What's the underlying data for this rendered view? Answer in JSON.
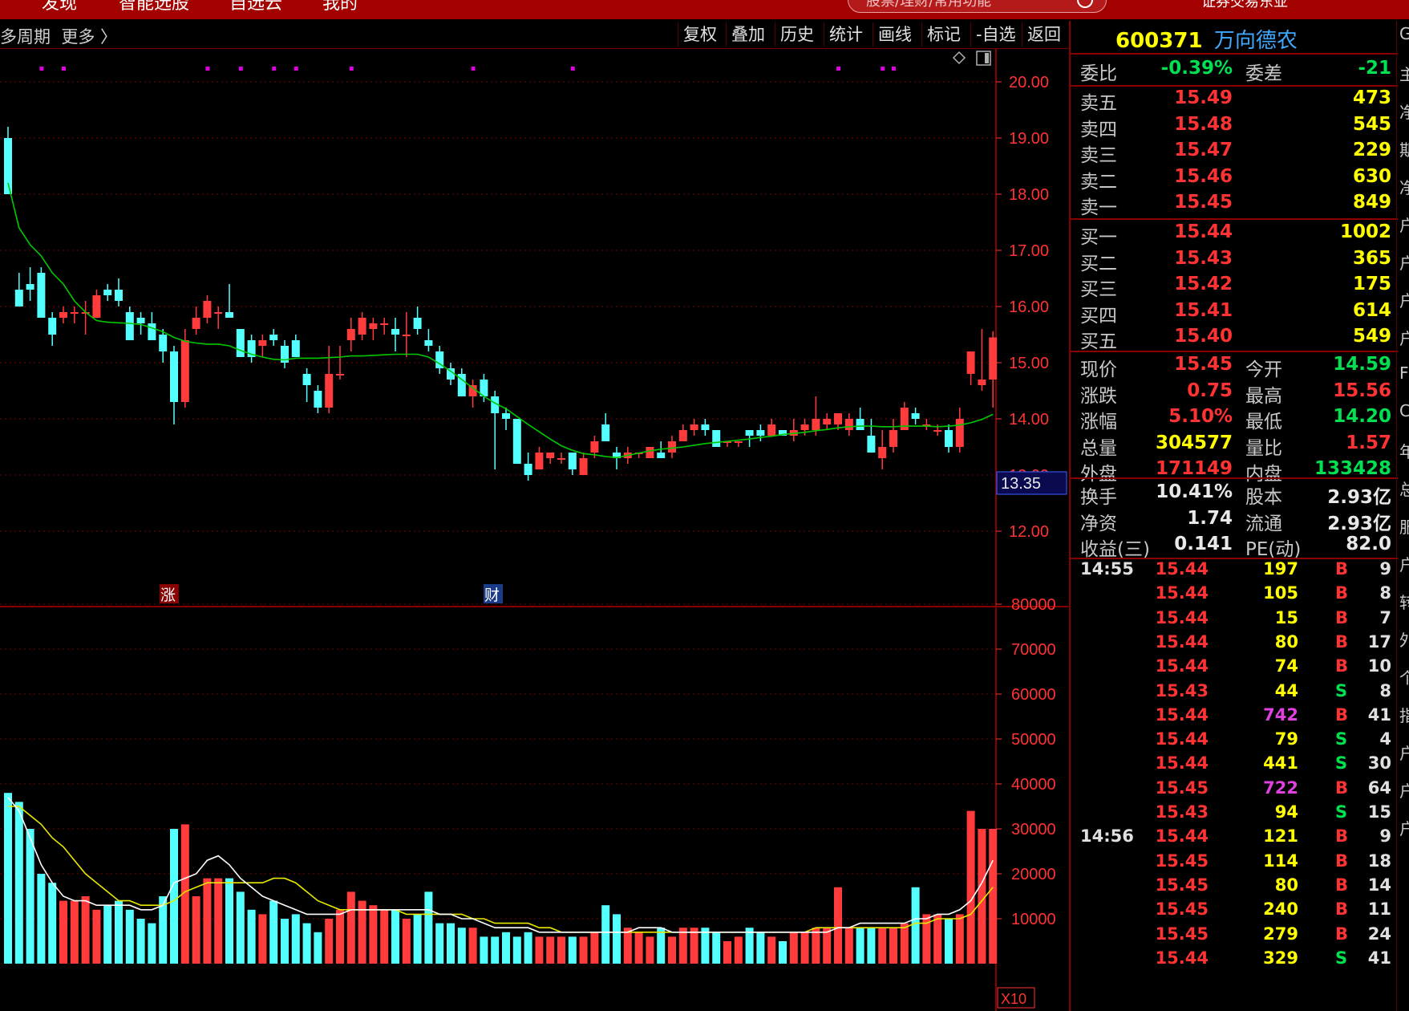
{
  "topnav": {
    "items": [
      "发现",
      "智能选股",
      "自选云",
      "我的"
    ],
    "search_placeholder": "股票/理财/常用功能",
    "right_text": "证券交易东亚"
  },
  "toolbar": {
    "period_label": "多周期",
    "more_label": "更多 〉",
    "buttons": [
      "复权",
      "叠加",
      "历史",
      "统计",
      "画线",
      "标记",
      "-自选",
      "返回"
    ]
  },
  "chart": {
    "price_axis_labels": [
      "20.00",
      "19.00",
      "18.00",
      "17.00",
      "16.00",
      "15.00",
      "14.00",
      "13.00",
      "12.00"
    ],
    "current_price_tag": "13.35",
    "volume_axis_labels": [
      "80000",
      "70000",
      "60000",
      "50000",
      "40000",
      "30000",
      "20000",
      "10000"
    ],
    "volume_unit_label": "X10",
    "event_marker_zhang": "涨",
    "event_marker_cai": "财",
    "colors": {
      "up": "#ff3b3b",
      "down": "#54ffff",
      "ma_green": "#00c800",
      "ma_white": "#ffffff",
      "ma_yellow": "#e8e800",
      "grid": "#7a0000",
      "marker_dot": "#e000e0"
    }
  },
  "chart_data": {
    "type": "candlestick",
    "ylim": [
      12,
      20.5
    ],
    "volume_ylim": [
      0,
      80000
    ],
    "candles": [
      {
        "o": 19.0,
        "h": 19.2,
        "l": 18.0,
        "c": 18.0
      },
      {
        "o": 16.3,
        "h": 16.6,
        "l": 16.0,
        "c": 16.0
      },
      {
        "o": 16.4,
        "h": 16.7,
        "l": 16.1,
        "c": 16.3
      },
      {
        "o": 16.6,
        "h": 16.7,
        "l": 15.8,
        "c": 15.8
      },
      {
        "o": 15.8,
        "h": 15.9,
        "l": 15.3,
        "c": 15.5
      },
      {
        "o": 15.8,
        "h": 16.0,
        "l": 15.7,
        "c": 15.9
      },
      {
        "o": 15.9,
        "h": 16.0,
        "l": 15.7,
        "c": 15.9
      },
      {
        "o": 15.9,
        "h": 16.1,
        "l": 15.5,
        "c": 15.9
      },
      {
        "o": 15.8,
        "h": 16.3,
        "l": 15.8,
        "c": 16.2
      },
      {
        "o": 16.3,
        "h": 16.4,
        "l": 16.1,
        "c": 16.2
      },
      {
        "o": 16.3,
        "h": 16.5,
        "l": 16.0,
        "c": 16.1
      },
      {
        "o": 15.9,
        "h": 16.0,
        "l": 15.4,
        "c": 15.4
      },
      {
        "o": 15.8,
        "h": 15.9,
        "l": 15.5,
        "c": 15.7
      },
      {
        "o": 15.7,
        "h": 15.9,
        "l": 15.4,
        "c": 15.4
      },
      {
        "o": 15.5,
        "h": 15.6,
        "l": 15.0,
        "c": 15.2
      },
      {
        "o": 15.2,
        "h": 15.3,
        "l": 13.9,
        "c": 14.3
      },
      {
        "o": 14.3,
        "h": 15.6,
        "l": 14.2,
        "c": 15.4
      },
      {
        "o": 15.6,
        "h": 16.0,
        "l": 15.5,
        "c": 15.8
      },
      {
        "o": 15.8,
        "h": 16.2,
        "l": 15.7,
        "c": 16.1
      },
      {
        "o": 15.9,
        "h": 16.0,
        "l": 15.6,
        "c": 15.9
      },
      {
        "o": 15.9,
        "h": 16.4,
        "l": 15.8,
        "c": 15.8
      },
      {
        "o": 15.6,
        "h": 15.6,
        "l": 15.1,
        "c": 15.1
      },
      {
        "o": 15.4,
        "h": 15.5,
        "l": 15.0,
        "c": 15.1
      },
      {
        "o": 15.3,
        "h": 15.5,
        "l": 15.1,
        "c": 15.4
      },
      {
        "o": 15.5,
        "h": 15.6,
        "l": 15.3,
        "c": 15.4
      },
      {
        "o": 15.3,
        "h": 15.4,
        "l": 14.9,
        "c": 15.0
      },
      {
        "o": 15.4,
        "h": 15.5,
        "l": 15.1,
        "c": 15.1
      },
      {
        "o": 14.8,
        "h": 14.9,
        "l": 14.3,
        "c": 14.6
      },
      {
        "o": 14.5,
        "h": 14.6,
        "l": 14.1,
        "c": 14.2
      },
      {
        "o": 14.2,
        "h": 15.3,
        "l": 14.1,
        "c": 14.8
      },
      {
        "o": 14.8,
        "h": 15.3,
        "l": 14.7,
        "c": 14.8
      },
      {
        "o": 15.4,
        "h": 15.8,
        "l": 15.2,
        "c": 15.6
      },
      {
        "o": 15.5,
        "h": 15.9,
        "l": 15.4,
        "c": 15.8
      },
      {
        "o": 15.6,
        "h": 15.8,
        "l": 15.4,
        "c": 15.7
      },
      {
        "o": 15.7,
        "h": 15.8,
        "l": 15.5,
        "c": 15.7
      },
      {
        "o": 15.6,
        "h": 15.8,
        "l": 15.2,
        "c": 15.5
      },
      {
        "o": 15.5,
        "h": 15.9,
        "l": 15.1,
        "c": 15.5
      },
      {
        "o": 15.8,
        "h": 16.0,
        "l": 15.5,
        "c": 15.6
      },
      {
        "o": 15.4,
        "h": 15.6,
        "l": 15.2,
        "c": 15.3
      },
      {
        "o": 15.2,
        "h": 15.3,
        "l": 14.8,
        "c": 14.9
      },
      {
        "o": 14.9,
        "h": 15.0,
        "l": 14.6,
        "c": 14.7
      },
      {
        "o": 14.8,
        "h": 14.9,
        "l": 14.4,
        "c": 14.4
      },
      {
        "o": 14.4,
        "h": 14.7,
        "l": 14.2,
        "c": 14.6
      },
      {
        "o": 14.7,
        "h": 14.8,
        "l": 14.3,
        "c": 14.4
      },
      {
        "o": 14.4,
        "h": 14.5,
        "l": 13.1,
        "c": 14.1
      },
      {
        "o": 14.1,
        "h": 14.2,
        "l": 13.8,
        "c": 14.0
      },
      {
        "o": 14.0,
        "h": 14.0,
        "l": 13.2,
        "c": 13.2
      },
      {
        "o": 13.2,
        "h": 13.4,
        "l": 12.9,
        "c": 13.0
      },
      {
        "o": 13.1,
        "h": 13.5,
        "l": 13.1,
        "c": 13.4
      },
      {
        "o": 13.3,
        "h": 13.4,
        "l": 13.2,
        "c": 13.4
      },
      {
        "o": 13.3,
        "h": 13.4,
        "l": 13.2,
        "c": 13.3
      },
      {
        "o": 13.4,
        "h": 13.4,
        "l": 13.0,
        "c": 13.1
      },
      {
        "o": 13.0,
        "h": 13.4,
        "l": 13.0,
        "c": 13.3
      },
      {
        "o": 13.4,
        "h": 13.7,
        "l": 13.3,
        "c": 13.6
      },
      {
        "o": 13.9,
        "h": 14.1,
        "l": 13.6,
        "c": 13.6
      },
      {
        "o": 13.4,
        "h": 13.5,
        "l": 13.1,
        "c": 13.3
      },
      {
        "o": 13.3,
        "h": 13.5,
        "l": 13.2,
        "c": 13.4
      },
      {
        "o": 13.4,
        "h": 13.4,
        "l": 13.3,
        "c": 13.4
      },
      {
        "o": 13.3,
        "h": 13.5,
        "l": 13.3,
        "c": 13.5
      },
      {
        "o": 13.4,
        "h": 13.6,
        "l": 13.3,
        "c": 13.3
      },
      {
        "o": 13.4,
        "h": 13.7,
        "l": 13.3,
        "c": 13.6
      },
      {
        "o": 13.6,
        "h": 13.9,
        "l": 13.6,
        "c": 13.8
      },
      {
        "o": 13.8,
        "h": 14.0,
        "l": 13.7,
        "c": 13.9
      },
      {
        "o": 13.9,
        "h": 14.0,
        "l": 13.7,
        "c": 13.8
      },
      {
        "o": 13.8,
        "h": 13.8,
        "l": 13.5,
        "c": 13.5
      },
      {
        "o": 13.6,
        "h": 13.6,
        "l": 13.5,
        "c": 13.6
      },
      {
        "o": 13.6,
        "h": 13.6,
        "l": 13.5,
        "c": 13.6
      },
      {
        "o": 13.8,
        "h": 13.8,
        "l": 13.5,
        "c": 13.7
      },
      {
        "o": 13.8,
        "h": 13.9,
        "l": 13.6,
        "c": 13.7
      },
      {
        "o": 13.7,
        "h": 14.0,
        "l": 13.7,
        "c": 13.9
      },
      {
        "o": 13.8,
        "h": 13.8,
        "l": 13.7,
        "c": 13.7
      },
      {
        "o": 13.7,
        "h": 14.0,
        "l": 13.6,
        "c": 13.8
      },
      {
        "o": 13.8,
        "h": 14.0,
        "l": 13.7,
        "c": 13.9
      },
      {
        "o": 13.8,
        "h": 14.4,
        "l": 13.7,
        "c": 14.0
      },
      {
        "o": 13.9,
        "h": 14.1,
        "l": 13.8,
        "c": 14.0
      },
      {
        "o": 13.9,
        "h": 14.1,
        "l": 13.8,
        "c": 14.1
      },
      {
        "o": 13.8,
        "h": 14.1,
        "l": 13.7,
        "c": 14.0
      },
      {
        "o": 14.0,
        "h": 14.2,
        "l": 13.8,
        "c": 13.8
      },
      {
        "o": 13.7,
        "h": 14.0,
        "l": 13.4,
        "c": 13.4
      },
      {
        "o": 13.3,
        "h": 13.8,
        "l": 13.1,
        "c": 13.5
      },
      {
        "o": 13.5,
        "h": 14.0,
        "l": 13.4,
        "c": 13.8
      },
      {
        "o": 13.8,
        "h": 14.3,
        "l": 13.8,
        "c": 14.2
      },
      {
        "o": 14.1,
        "h": 14.2,
        "l": 13.9,
        "c": 14.0
      },
      {
        "o": 13.9,
        "h": 14.0,
        "l": 13.8,
        "c": 13.9
      },
      {
        "o": 13.8,
        "h": 13.9,
        "l": 13.7,
        "c": 13.8
      },
      {
        "o": 13.8,
        "h": 13.9,
        "l": 13.4,
        "c": 13.5
      },
      {
        "o": 13.5,
        "h": 14.2,
        "l": 13.4,
        "c": 14.0
      },
      {
        "o": 14.8,
        "h": 15.2,
        "l": 14.6,
        "c": 15.2
      },
      {
        "o": 14.6,
        "h": 15.6,
        "l": 14.5,
        "c": 14.7
      },
      {
        "o": 14.7,
        "h": 15.56,
        "l": 14.2,
        "c": 15.45
      }
    ],
    "ma": [
      18.2,
      17.4,
      17.1,
      16.9,
      16.6,
      16.4,
      16.1,
      15.9,
      15.75,
      15.72,
      15.71,
      15.7,
      15.68,
      15.62,
      15.55,
      15.45,
      15.38,
      15.35,
      15.33,
      15.33,
      15.3,
      15.22,
      15.15,
      15.1,
      15.06,
      15.05,
      15.08,
      15.08,
      15.08,
      15.09,
      15.1,
      15.12,
      15.12,
      15.13,
      15.14,
      15.15,
      15.15,
      15.15,
      15.1,
      14.98,
      14.85,
      14.7,
      14.55,
      14.4,
      14.28,
      14.18,
      14.04,
      13.9,
      13.77,
      13.64,
      13.52,
      13.44,
      13.38,
      13.36,
      13.33,
      13.31,
      13.35,
      13.39,
      13.43,
      13.46,
      13.48,
      13.5,
      13.53,
      13.56,
      13.58,
      13.6,
      13.62,
      13.64,
      13.67,
      13.69,
      13.72,
      13.74,
      13.76,
      13.79,
      13.81,
      13.84,
      13.86,
      13.87,
      13.87,
      13.86,
      13.86,
      13.87,
      13.87,
      13.87,
      13.86,
      13.87,
      13.89,
      13.93,
      13.99,
      14.08
    ],
    "volumes": [
      38000,
      36000,
      30000,
      20000,
      18000,
      14000,
      14000,
      15000,
      12000,
      13000,
      14000,
      12000,
      10000,
      9000,
      15000,
      30000,
      31000,
      15000,
      19000,
      19000,
      19000,
      16000,
      12000,
      11000,
      14000,
      10000,
      11000,
      9000,
      7000,
      10000,
      12000,
      16000,
      14000,
      13000,
      12000,
      12000,
      10000,
      11000,
      16000,
      9000,
      9000,
      8000,
      8000,
      6000,
      6000,
      7000,
      6000,
      7000,
      6000,
      6000,
      6000,
      6000,
      6000,
      7000,
      13000,
      11000,
      8000,
      7000,
      6000,
      8000,
      6000,
      8000,
      8000,
      8000,
      7000,
      5000,
      6000,
      8000,
      7000,
      6000,
      5000,
      7000,
      7000,
      8000,
      8000,
      17000,
      8000,
      8000,
      8000,
      8000,
      8000,
      9000,
      17000,
      11000,
      11000,
      10000,
      11000,
      34000,
      30000,
      30000
    ],
    "vol_ma_white": [
      37000,
      34000,
      28000,
      22000,
      18000,
      15000,
      14000,
      14000,
      13000,
      13000,
      13000,
      13000,
      12000,
      12000,
      13000,
      18000,
      19000,
      20000,
      23000,
      24000,
      22000,
      19000,
      17000,
      15000,
      14000,
      13000,
      12000,
      11000,
      11000,
      11000,
      11000,
      12000,
      12000,
      12000,
      12000,
      12000,
      12000,
      12000,
      12000,
      11000,
      11000,
      10000,
      10000,
      9000,
      8000,
      8000,
      8000,
      8000,
      7000,
      7000,
      7000,
      7000,
      7000,
      7000,
      7000,
      7000,
      7000,
      8000,
      8000,
      8000,
      7000,
      7000,
      7000,
      7000,
      7000,
      7000,
      7000,
      7000,
      7000,
      7000,
      7000,
      7000,
      7000,
      7000,
      7000,
      8000,
      8000,
      9000,
      9000,
      9000,
      9000,
      9000,
      10000,
      10000,
      11000,
      11000,
      12000,
      14000,
      18000,
      23000
    ],
    "vol_ma_yellow": [
      35000,
      35000,
      33000,
      31000,
      28000,
      26000,
      23000,
      20000,
      18000,
      16000,
      14000,
      14000,
      13000,
      13000,
      13000,
      14000,
      16000,
      17000,
      18000,
      18000,
      18000,
      18000,
      18000,
      18000,
      19000,
      19000,
      18000,
      16000,
      14000,
      13000,
      12000,
      12000,
      12000,
      12000,
      12000,
      12000,
      11000,
      11000,
      11000,
      11000,
      11000,
      11000,
      10000,
      10000,
      9000,
      9000,
      9000,
      9000,
      8000,
      8000,
      7000,
      7000,
      7000,
      7000,
      7000,
      7000,
      7000,
      7000,
      7000,
      7000,
      7000,
      7000,
      7000,
      7000,
      7000,
      7000,
      7000,
      7000,
      7000,
      7000,
      7000,
      7000,
      7000,
      8000,
      8000,
      8000,
      8000,
      8000,
      8000,
      8000,
      8000,
      8000,
      9000,
      9000,
      10000,
      10000,
      10000,
      11000,
      14000,
      17000
    ],
    "magenta_dot_indices": [
      3,
      5,
      18,
      21,
      24,
      26,
      31,
      42,
      51,
      75,
      79,
      80
    ]
  },
  "sidebar": {
    "stock_code": "600371",
    "stock_name": "万向德农",
    "webi": {
      "label": "委比",
      "value": "-0.39%",
      "label2": "委差",
      "value2": "-21"
    },
    "sells": [
      {
        "label": "卖五",
        "price": "15.49",
        "vol": "473"
      },
      {
        "label": "卖四",
        "price": "15.48",
        "vol": "545"
      },
      {
        "label": "卖三",
        "price": "15.47",
        "vol": "229"
      },
      {
        "label": "卖二",
        "price": "15.46",
        "vol": "630"
      },
      {
        "label": "卖一",
        "price": "15.45",
        "vol": "849"
      }
    ],
    "buys": [
      {
        "label": "买一",
        "price": "15.44",
        "vol": "1002"
      },
      {
        "label": "买二",
        "price": "15.43",
        "vol": "365"
      },
      {
        "label": "买三",
        "price": "15.42",
        "vol": "175"
      },
      {
        "label": "买四",
        "price": "15.41",
        "vol": "614"
      },
      {
        "label": "买五",
        "price": "15.40",
        "vol": "549"
      }
    ],
    "stats": [
      {
        "l1": "现价",
        "v1": "15.45",
        "c1": "red",
        "l2": "今开",
        "v2": "14.59",
        "c2": "green"
      },
      {
        "l1": "涨跌",
        "v1": "0.75",
        "c1": "red",
        "l2": "最高",
        "v2": "15.56",
        "c2": "red"
      },
      {
        "l1": "涨幅",
        "v1": "5.10%",
        "c1": "red",
        "l2": "最低",
        "v2": "14.20",
        "c2": "green"
      },
      {
        "l1": "总量",
        "v1": "304577",
        "c1": "yellow",
        "l2": "量比",
        "v2": "1.57",
        "c2": "red"
      },
      {
        "l1": "外盘",
        "v1": "171149",
        "c1": "red",
        "l2": "内盘",
        "v2": "133428",
        "c2": "green"
      }
    ],
    "fund": [
      {
        "l1": "换手",
        "v1": "10.41%",
        "l2": "股本",
        "v2": "2.93亿"
      },
      {
        "l1": "净资",
        "v1": "1.74",
        "l2": "流通",
        "v2": "2.93亿"
      },
      {
        "l1": "收益(三)",
        "v1": "0.141",
        "l2": "PE(动)",
        "v2": "82.0"
      }
    ],
    "ticks": [
      {
        "time": "14:55",
        "price": "15.44",
        "vol": "197",
        "vc": "yellow",
        "dir": "B",
        "cnt": "9"
      },
      {
        "time": "",
        "price": "15.44",
        "vol": "105",
        "vc": "yellow",
        "dir": "B",
        "cnt": "8"
      },
      {
        "time": "",
        "price": "15.44",
        "vol": "15",
        "vc": "yellow",
        "dir": "B",
        "cnt": "7"
      },
      {
        "time": "",
        "price": "15.44",
        "vol": "80",
        "vc": "yellow",
        "dir": "B",
        "cnt": "17"
      },
      {
        "time": "",
        "price": "15.44",
        "vol": "74",
        "vc": "yellow",
        "dir": "B",
        "cnt": "10"
      },
      {
        "time": "",
        "price": "15.43",
        "vol": "44",
        "vc": "yellow",
        "dir": "S",
        "cnt": "8"
      },
      {
        "time": "",
        "price": "15.44",
        "vol": "742",
        "vc": "magenta",
        "dir": "B",
        "cnt": "41"
      },
      {
        "time": "",
        "price": "15.44",
        "vol": "79",
        "vc": "yellow",
        "dir": "S",
        "cnt": "4"
      },
      {
        "time": "",
        "price": "15.44",
        "vol": "441",
        "vc": "yellow",
        "dir": "S",
        "cnt": "30"
      },
      {
        "time": "",
        "price": "15.45",
        "vol": "722",
        "vc": "magenta",
        "dir": "B",
        "cnt": "64"
      },
      {
        "time": "",
        "price": "15.43",
        "vol": "94",
        "vc": "yellow",
        "dir": "S",
        "cnt": "15"
      },
      {
        "time": "14:56",
        "price": "15.44",
        "vol": "121",
        "vc": "yellow",
        "dir": "B",
        "cnt": "9"
      },
      {
        "time": "",
        "price": "15.45",
        "vol": "114",
        "vc": "yellow",
        "dir": "B",
        "cnt": "18"
      },
      {
        "time": "",
        "price": "15.45",
        "vol": "80",
        "vc": "yellow",
        "dir": "B",
        "cnt": "14"
      },
      {
        "time": "",
        "price": "15.45",
        "vol": "240",
        "vc": "yellow",
        "dir": "B",
        "cnt": "11"
      },
      {
        "time": "",
        "price": "15.45",
        "vol": "279",
        "vc": "yellow",
        "dir": "B",
        "cnt": "24"
      },
      {
        "time": "",
        "price": "15.44",
        "vol": "329",
        "vc": "yellow",
        "dir": "S",
        "cnt": "41"
      }
    ]
  },
  "right_edge_chars": [
    "G",
    "主",
    "净",
    "期",
    "净",
    "户",
    "户",
    "户",
    "户",
    "F",
    "C",
    "年",
    "总",
    "服",
    "户",
    "转",
    "外",
    "个",
    "指",
    "户",
    "户",
    "户"
  ]
}
